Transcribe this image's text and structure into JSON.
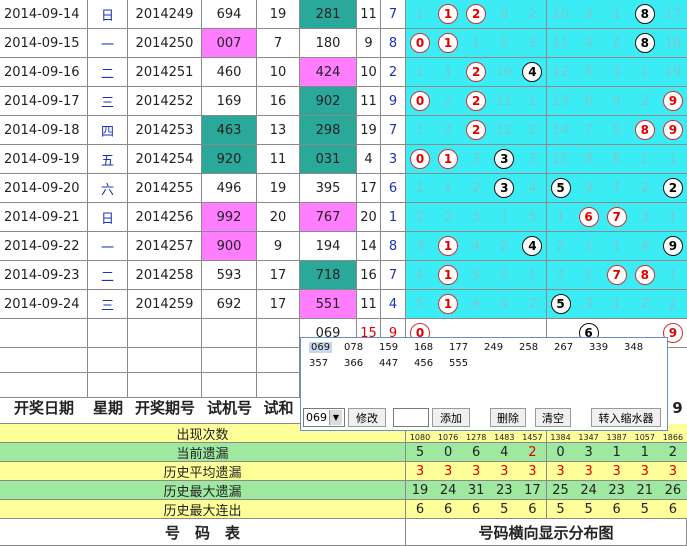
{
  "rows": [
    {
      "date": "2014-09-14",
      "week": "日",
      "issue": "2014249",
      "trial": "694",
      "trial_sum": "19",
      "draw": "281",
      "sum": "11",
      "span": "7"
    },
    {
      "date": "2014-09-15",
      "week": "一",
      "issue": "2014250",
      "trial": "007",
      "trial_sum": "7",
      "draw": "180",
      "sum": "9",
      "span": "8"
    },
    {
      "date": "2014-09-16",
      "week": "二",
      "issue": "2014251",
      "trial": "460",
      "trial_sum": "10",
      "draw": "424",
      "sum": "10",
      "span": "2"
    },
    {
      "date": "2014-09-17",
      "week": "三",
      "issue": "2014252",
      "trial": "169",
      "trial_sum": "16",
      "draw": "902",
      "sum": "11",
      "span": "9"
    },
    {
      "date": "2014-09-18",
      "week": "四",
      "issue": "2014253",
      "trial": "463",
      "trial_sum": "13",
      "draw": "298",
      "sum": "19",
      "span": "7"
    },
    {
      "date": "2014-09-19",
      "week": "五",
      "issue": "2014254",
      "trial": "920",
      "trial_sum": "11",
      "draw": "031",
      "sum": "4",
      "span": "3"
    },
    {
      "date": "2014-09-20",
      "week": "六",
      "issue": "2014255",
      "trial": "496",
      "trial_sum": "19",
      "draw": "395",
      "sum": "17",
      "span": "6"
    },
    {
      "date": "2014-09-21",
      "week": "日",
      "issue": "2014256",
      "trial": "992",
      "trial_sum": "20",
      "draw": "767",
      "sum": "20",
      "span": "1"
    },
    {
      "date": "2014-09-22",
      "week": "一",
      "issue": "2014257",
      "trial": "900",
      "trial_sum": "9",
      "draw": "194",
      "sum": "14",
      "span": "8"
    },
    {
      "date": "2014-09-23",
      "week": "二",
      "issue": "2014258",
      "trial": "593",
      "trial_sum": "17",
      "draw": "718",
      "sum": "16",
      "span": "7"
    },
    {
      "date": "2014-09-24",
      "week": "三",
      "issue": "2014259",
      "trial": "692",
      "trial_sum": "17",
      "draw": "551",
      "sum": "11",
      "span": "4"
    }
  ],
  "dist": [
    [
      "1",
      "1",
      "2",
      "8",
      "2",
      "10",
      "3",
      "1",
      "8",
      "17"
    ],
    [
      "0",
      "1",
      "1",
      "9",
      "3",
      "11",
      "4",
      "2",
      "8",
      "18"
    ],
    [
      "1",
      "1",
      "2",
      "10",
      "4",
      "12",
      "5",
      "3",
      "1",
      "19"
    ],
    [
      "0",
      "2",
      "2",
      "11",
      "1",
      "13",
      "6",
      "4",
      "2",
      "9"
    ],
    [
      "1",
      "3",
      "2",
      "12",
      "2",
      "14",
      "7",
      "5",
      "8",
      "9"
    ],
    [
      "0",
      "1",
      "3",
      "3",
      "3",
      "15",
      "8",
      "6",
      "1",
      "1"
    ],
    [
      "1",
      "1",
      "2",
      "3",
      "4",
      "5",
      "9",
      "7",
      "2",
      "2"
    ],
    [
      "2",
      "2",
      "3",
      "1",
      "5",
      "1",
      "6",
      "7",
      "3",
      "1"
    ],
    [
      "3",
      "1",
      "4",
      "2",
      "4",
      "2",
      "1",
      "1",
      "4",
      "9"
    ],
    [
      "4",
      "1",
      "5",
      "3",
      "1",
      "3",
      "2",
      "7",
      "8",
      "1"
    ],
    [
      "5",
      "1",
      "6",
      "4",
      "2",
      "5",
      "3",
      "1",
      "2",
      "2"
    ]
  ],
  "balls": [
    [
      1,
      2,
      8
    ],
    [
      0,
      1,
      8
    ],
    [
      2,
      4
    ],
    [
      0,
      2,
      9
    ],
    [
      2,
      8,
      9
    ],
    [
      0,
      1,
      3
    ],
    [
      3,
      5,
      9
    ],
    [
      6,
      7
    ],
    [
      1,
      4,
      9
    ],
    [
      1,
      7,
      8
    ],
    [
      1,
      5
    ]
  ],
  "pending": {
    "draw": "069",
    "sum": "15",
    "span": "9",
    "b0": "0",
    "b6": "6",
    "b9": "9"
  },
  "header": {
    "date": "开奖日期",
    "week": "星期",
    "issue": "开奖期号",
    "trial": "试机号",
    "trial_sum": "试和",
    "last": "9"
  },
  "stats": [
    {
      "label": "出现次数",
      "values": [
        "1080",
        "1076",
        "1278",
        "1483",
        "1457",
        "1384",
        "1347",
        "1387",
        "1057",
        "1866"
      ]
    },
    {
      "label": "当前遗漏",
      "values": [
        "5",
        "0",
        "6",
        "4",
        "2",
        "0",
        "3",
        "1",
        "1",
        "2"
      ]
    },
    {
      "label": "历史平均遗漏",
      "values": [
        "3",
        "3",
        "3",
        "3",
        "3",
        "3",
        "3",
        "3",
        "3",
        "3"
      ]
    },
    {
      "label": "历史最大遗漏",
      "values": [
        "19",
        "24",
        "31",
        "23",
        "17",
        "25",
        "24",
        "23",
        "21",
        "26"
      ]
    },
    {
      "label": "历史最大连出",
      "values": [
        "6",
        "6",
        "6",
        "5",
        "6",
        "5",
        "5",
        "6",
        "5",
        "6"
      ]
    }
  ],
  "footer": {
    "left": "号　码　表",
    "right": "号码横向显示分布图"
  },
  "popup": {
    "options_row1": [
      "069",
      "078",
      "159",
      "168",
      "177",
      "249",
      "258",
      "267",
      "339",
      "348"
    ],
    "options_row2": [
      "357",
      "366",
      "447",
      "456",
      "555"
    ],
    "select_value": "069",
    "btn_modify": "修改",
    "btn_add": "添加",
    "btn_delete": "删除",
    "btn_clear": "清空",
    "btn_transfer": "转入缩水器"
  },
  "colors": {
    "teal": "#2aa89a",
    "pink": "#ff7dff",
    "cyan": "#3cecf4",
    "yellow": "#ffff99",
    "green": "#9fe8a0"
  }
}
